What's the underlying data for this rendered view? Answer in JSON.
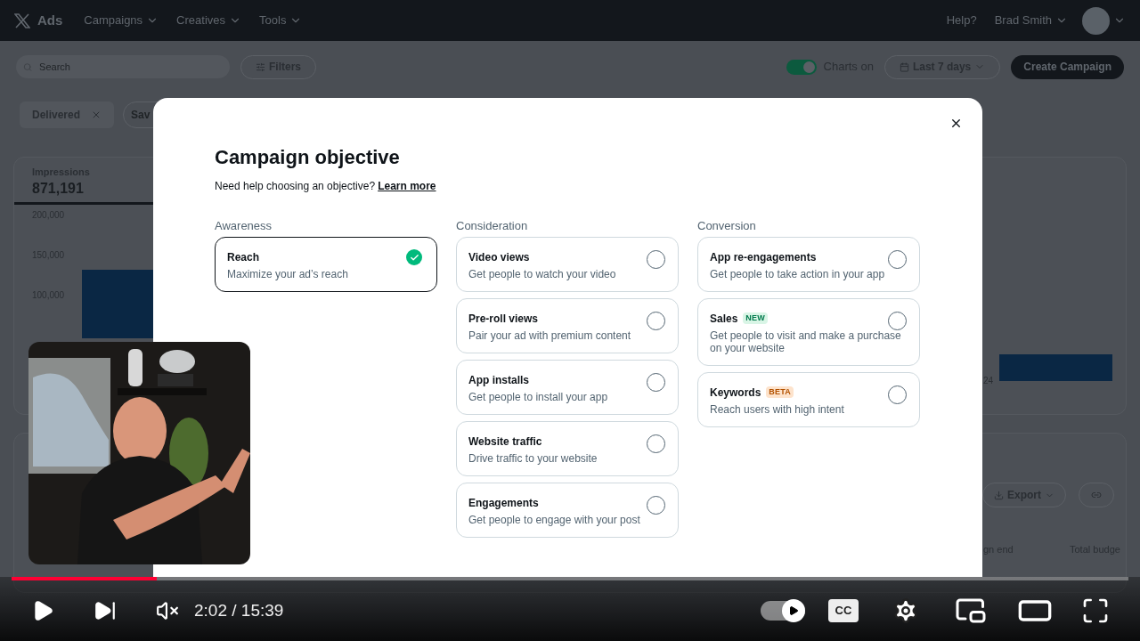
{
  "app": {
    "nav": {
      "brand": "Ads",
      "menus": [
        "Campaigns",
        "Creatives",
        "Tools"
      ],
      "help": "Help?",
      "user": "Brad Smith"
    },
    "toolbar": {
      "search": {
        "placeholder": "Search"
      },
      "filters": "Filters",
      "charts_toggle": {
        "on": true,
        "label": "Charts on"
      },
      "date_range": "Last 7 days",
      "create": "Create Campaign"
    },
    "chips": [
      {
        "label": "Delivered"
      }
    ],
    "saved_button": "Sav",
    "metric": {
      "label": "Impressions",
      "value": "871,191",
      "selected": true
    },
    "chart": {
      "y_axis_labels": [
        "200,000",
        "150,000",
        "100,000"
      ],
      "x_label_fragment": "24"
    },
    "table": {
      "export": "Export",
      "columns": [
        "gn end",
        "Total budge"
      ]
    }
  },
  "modal": {
    "title": "Campaign objective",
    "help_text": "Need help choosing an objective?",
    "help_link": "Learn more",
    "groups": [
      {
        "heading": "Awareness",
        "options": [
          {
            "title": "Reach",
            "description": "Maximize your ad’s reach",
            "selected": true
          }
        ]
      },
      {
        "heading": "Consideration",
        "options": [
          {
            "title": "Video views",
            "description": "Get people to watch your video",
            "selected": false
          },
          {
            "title": "Pre-roll views",
            "description": "Pair your ad with premium content",
            "selected": false
          },
          {
            "title": "App installs",
            "description": "Get people to install your app",
            "selected": false
          },
          {
            "title": "Website traffic",
            "description": "Drive traffic to your website",
            "selected": false
          },
          {
            "title": "Engagements",
            "description": "Get people to engage with your post",
            "selected": false
          }
        ]
      },
      {
        "heading": "Conversion",
        "options": [
          {
            "title": "App re-engagements",
            "description": "Get people to take action in your app",
            "selected": false
          },
          {
            "title": "Sales",
            "badge": {
              "text": "NEW",
              "kind": "new"
            },
            "description": "Get people to visit and make a purchase on your website",
            "selected": false
          },
          {
            "title": "Keywords",
            "badge": {
              "text": "BETA",
              "kind": "beta"
            },
            "description": "Reach users with high intent",
            "selected": false
          }
        ]
      }
    ]
  },
  "player": {
    "progress": {
      "level": 0.13
    },
    "time": "2:02 / 15:39",
    "muted": true,
    "autoplay": {
      "on": true
    },
    "captions_label": "CC"
  }
}
